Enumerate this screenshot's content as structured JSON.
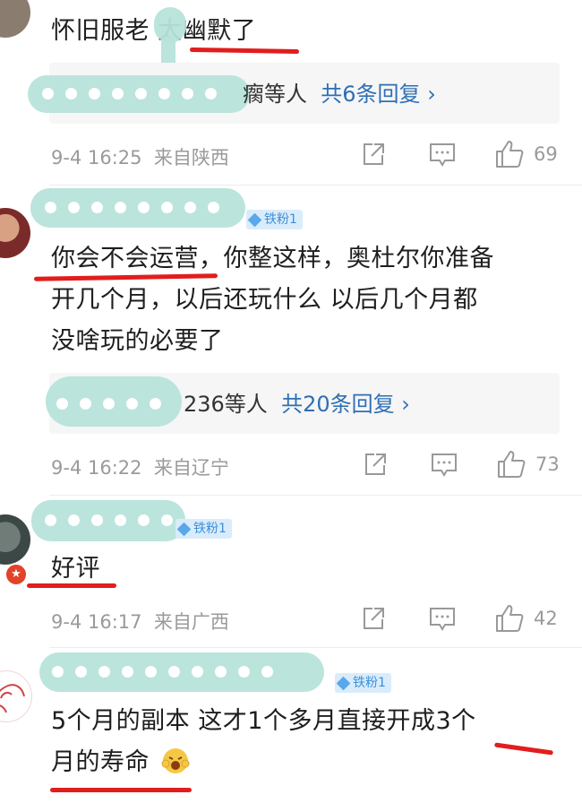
{
  "comments": [
    {
      "text_lines": [
        "怀旧服老  太幽默了"
      ],
      "reply_suffix": "瘸等人",
      "reply_count": "共6条回复",
      "chevron": "›",
      "time": "9-4 16:25",
      "location": "来自陕西",
      "likes": "69"
    },
    {
      "badge": "铁粉1",
      "text_lines": [
        "你会不会运营，你整这样，奥杜尔你准备",
        "开几个月，以后还玩什么  以后几个月都",
        "没啥玩的必要了"
      ],
      "reply_suffix": "236等人",
      "reply_count": "共20条回复",
      "chevron": "›",
      "time": "9-4 16:22",
      "location": "来自辽宁",
      "likes": "73"
    },
    {
      "badge": "铁粉1",
      "text_lines": [
        "好评"
      ],
      "time": "9-4 16:17",
      "location": "来自广西",
      "likes": "42"
    },
    {
      "badge": "铁粉1",
      "text_lines": [
        "5个月的副本  这才1个多月直接开成3个",
        "月的寿命"
      ]
    }
  ],
  "icons": {
    "share": "share-icon",
    "comment": "comment-icon",
    "like": "thumbs-up-icon",
    "emoji": "laugh-emoji-icon"
  },
  "colors": {
    "reply_link": "#2f6fb5",
    "annotation_red": "#e21d1d",
    "redaction": "#b7e3da",
    "badge_bg": "#d9ecfb"
  }
}
